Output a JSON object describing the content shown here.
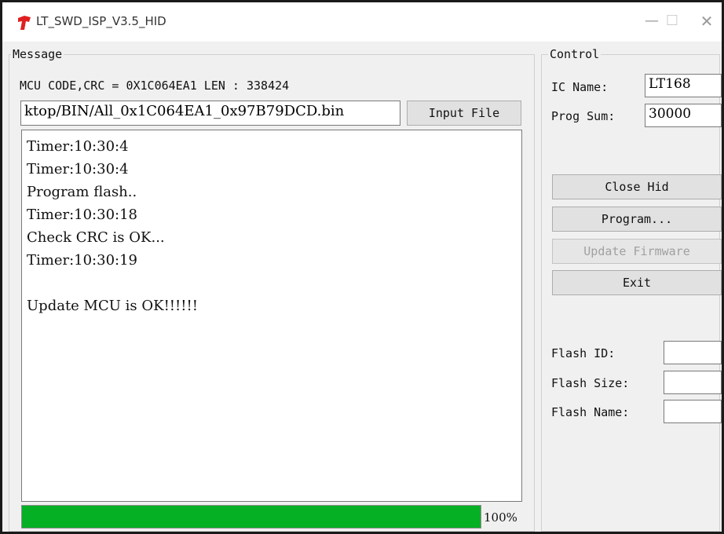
{
  "window": {
    "title": "LT_SWD_ISP_V3.5_HID",
    "minimize_glyph": "—",
    "maximize_glyph": "☐",
    "close_glyph": "✕",
    "icon": "lt-app-icon",
    "icon_color": "#e02020"
  },
  "message": {
    "group_label": "Message",
    "mcu_info": "MCU CODE,CRC = 0X1C064EA1  LEN : 338424",
    "file_path": "ktop/BIN/All_0x1C064EA1_0x97B79DCD.bin",
    "input_file_button": "Input File",
    "log": [
      "Timer:10:30:4",
      "Timer:10:30:4",
      "Program flash..",
      "Timer:10:30:18",
      "Check CRC is OK...",
      "Timer:10:30:19",
      "",
      "Update MCU is OK!!!!!!"
    ],
    "progress_percent": 100,
    "progress_text": "100%",
    "progress_color": "#06b025"
  },
  "control": {
    "group_label": "Control",
    "ic_name_label": "IC Name:",
    "ic_name_value": "LT168",
    "prog_sum_label": "Prog Sum:",
    "prog_sum_value": "30000",
    "close_hid_button": "Close Hid",
    "program_button": "Program...",
    "update_firmware_button": "Update Firmware",
    "exit_button": "Exit",
    "flash_id_label": "Flash ID:",
    "flash_id_value": "",
    "flash_size_label": "Flash Size:",
    "flash_size_value": "",
    "flash_name_label": "Flash Name:",
    "flash_name_value": ""
  }
}
